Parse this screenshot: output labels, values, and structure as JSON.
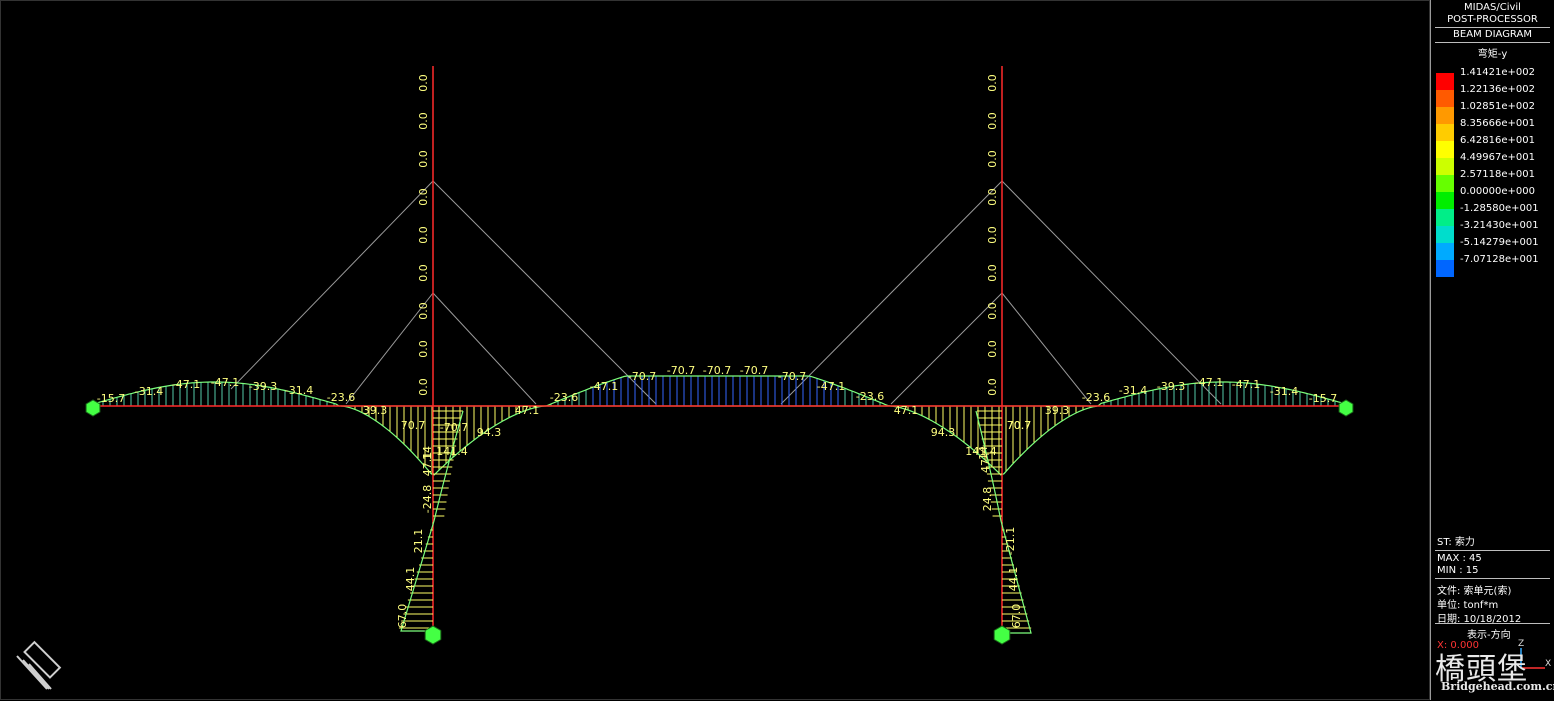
{
  "viewport": {
    "beam_labels_top": [
      "-15.7",
      "-31.4",
      "-47.1",
      "-47.1",
      "-39.3",
      "-31.4",
      "-23.6",
      "-23.6",
      "-47.1",
      "-70.7",
      "-70.7",
      "-70.7",
      "-70.7",
      "-70.7",
      "-47.1",
      "-23.6",
      "-23.6",
      "-31.4",
      "-39.3",
      "-47.1",
      "-47.1",
      "-31.4",
      "-15.7"
    ],
    "beam_labels_bottom": [
      "39.3",
      "70.7",
      "-70.7",
      "141.4",
      "94.3",
      "47.1",
      "47.1",
      "94.3",
      "70.7",
      "141.4",
      "70.7",
      "39.3"
    ],
    "tower_labels": [
      "0.0",
      "0.0",
      "0.0",
      "0.0",
      "0.0",
      "0.0",
      "0.0",
      "0.0",
      "0.0"
    ],
    "pier_left_labels": [
      "67.0",
      "44.1",
      "21.1",
      "-24.8",
      "47.1",
      "14"
    ],
    "pier_right_labels": [
      "67.0",
      "44.1",
      "-21.1",
      "24.8",
      "47",
      "14"
    ]
  },
  "legend": {
    "title_lines": [
      "MIDAS/Civil",
      "POST-PROCESSOR"
    ],
    "subtitle": "BEAM DIAGRAM",
    "component": "弯矩-y",
    "scale": [
      {
        "color": "#ff0000",
        "label": "1.41421e+002"
      },
      {
        "color": "#ff5a00",
        "label": "1.22136e+002"
      },
      {
        "color": "#ff9900",
        "label": "1.02851e+002"
      },
      {
        "color": "#ffcc00",
        "label": "8.35666e+001"
      },
      {
        "color": "#ffff00",
        "label": "6.42816e+001"
      },
      {
        "color": "#ccff00",
        "label": "4.49967e+001"
      },
      {
        "color": "#66ff00",
        "label": "2.57118e+001"
      },
      {
        "color": "#00ee00",
        "label": "0.00000e+000"
      },
      {
        "color": "#00ee88",
        "label": "-1.28580e+001"
      },
      {
        "color": "#00ddcc",
        "label": "-3.21430e+001"
      },
      {
        "color": "#00aaff",
        "label": "-5.14279e+001"
      },
      {
        "color": "#0066ff",
        "label": "-7.07128e+001"
      }
    ],
    "st": "ST: 索力",
    "max": "MAX : 45",
    "min": "MIN : 15",
    "file": "文件: 索单元(索)",
    "unit": "单位: tonf*m",
    "date": "日期: 10/18/2012",
    "view_dir": "表示-方向",
    "x": "X: 0.000",
    "z_axis": "Z",
    "x_axis": "X"
  },
  "watermark": {
    "cn": "橋頭堡",
    "url": "Bridgehead.com.cn"
  },
  "colors": {
    "beam": "#ff2a2a",
    "fill_pos": "#ffff66",
    "fill_neg": "#3366ff",
    "curve": "#7cff7c",
    "label": "#ffff80"
  }
}
